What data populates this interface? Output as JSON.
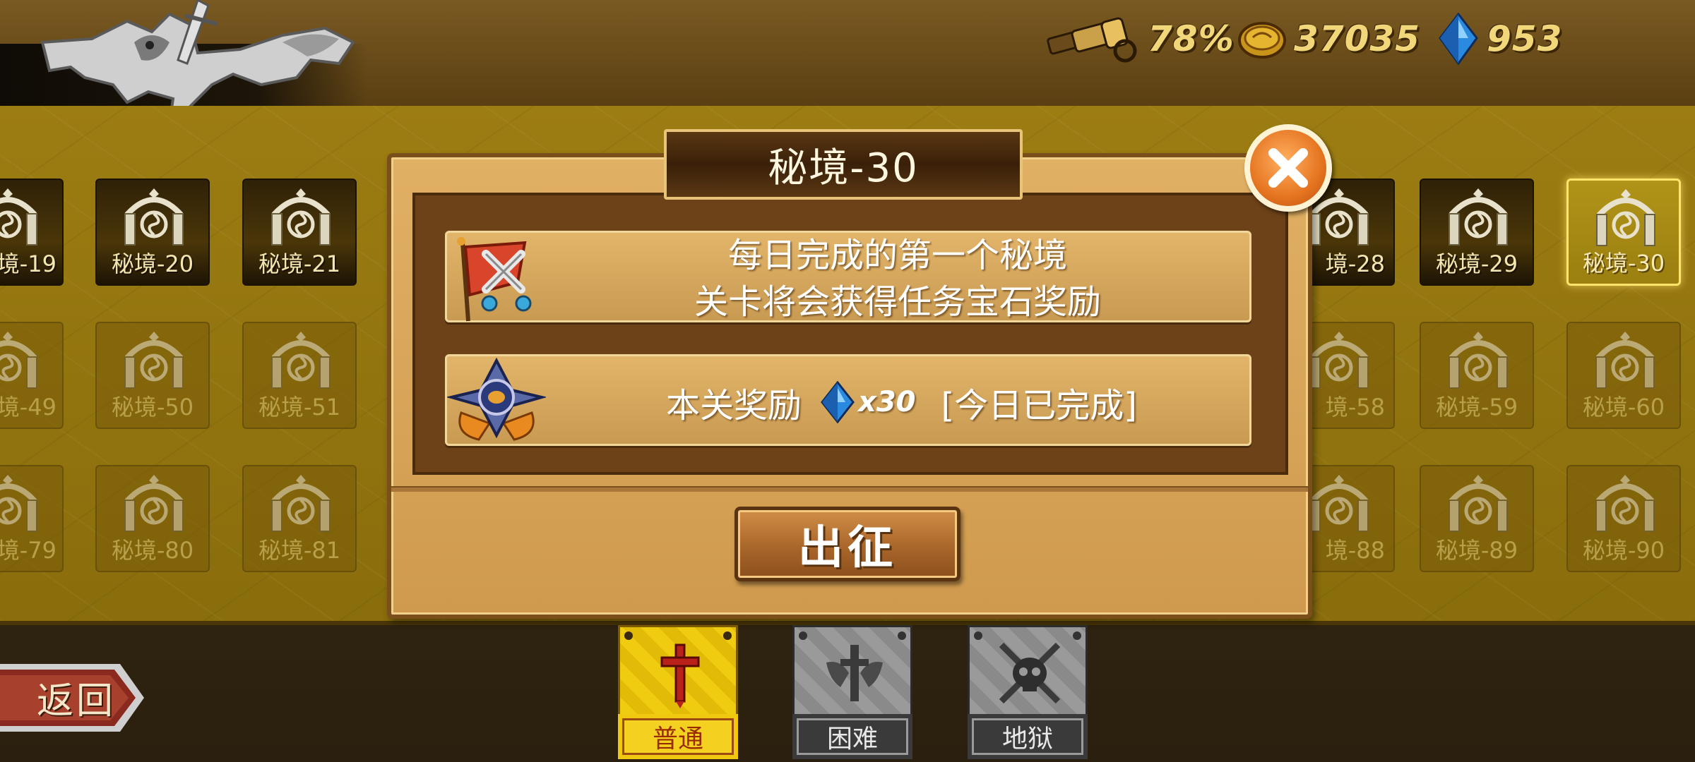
{
  "resources": {
    "spyglass_value": "78%",
    "gold_value": "37035",
    "gem_value": "953"
  },
  "levels": {
    "row1": [
      {
        "label": "境-19",
        "state": "unlocked"
      },
      {
        "label": "秘境-20",
        "state": "unlocked"
      },
      {
        "label": "秘境-21",
        "state": "unlocked"
      },
      {
        "label": "境-28",
        "state": "unlocked"
      },
      {
        "label": "秘境-29",
        "state": "unlocked"
      },
      {
        "label": "秘境-30",
        "state": "current"
      }
    ],
    "row2": [
      {
        "label": "境-49",
        "state": "locked"
      },
      {
        "label": "秘境-50",
        "state": "locked"
      },
      {
        "label": "秘境-51",
        "state": "locked"
      },
      {
        "label": "境-58",
        "state": "locked"
      },
      {
        "label": "秘境-59",
        "state": "locked"
      },
      {
        "label": "秘境-60",
        "state": "locked"
      }
    ],
    "row3": [
      {
        "label": "境-79",
        "state": "locked"
      },
      {
        "label": "秘境-80",
        "state": "locked"
      },
      {
        "label": "秘境-81",
        "state": "locked"
      },
      {
        "label": "境-88",
        "state": "locked"
      },
      {
        "label": "秘境-89",
        "state": "locked"
      },
      {
        "label": "秘境-90",
        "state": "locked"
      }
    ]
  },
  "dialog": {
    "title": "秘境-30",
    "info_line1": "每日完成的第一个秘境",
    "info_line2": "关卡将会获得任务宝石奖励",
    "reward_label": "本关奖励",
    "reward_amount": "x30",
    "reward_status": "[今日已完成]",
    "go_button": "出征"
  },
  "back_button": "返回",
  "difficulty": {
    "normal": "普通",
    "hard": "困难",
    "hell": "地狱",
    "selected": "普通"
  },
  "colors": {
    "board_yellow": "#9c7d12",
    "modal_tan": "#e0b064",
    "close_orange": "#e57420",
    "active_difficulty": "#f0cc10"
  }
}
